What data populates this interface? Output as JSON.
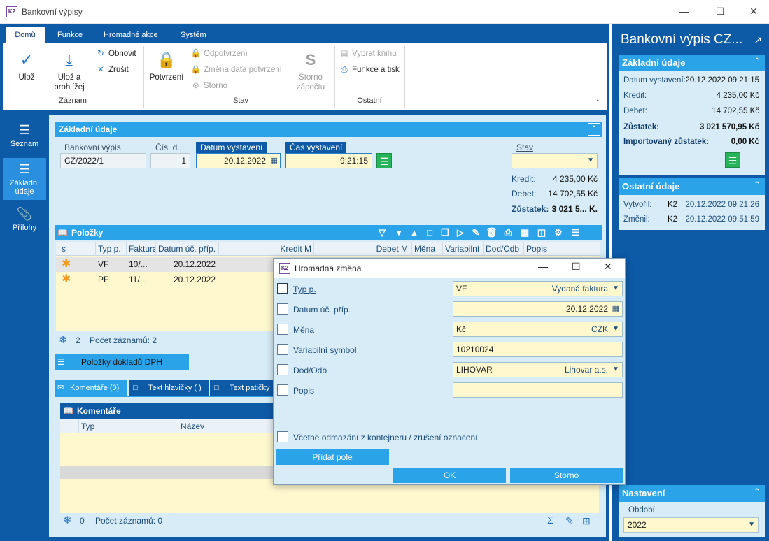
{
  "window": {
    "title": "Bankovní výpisy"
  },
  "ribbon": {
    "tabs": [
      "Domů",
      "Funkce",
      "Hromadné akce",
      "Systém"
    ],
    "zaznam": {
      "label": "Záznam",
      "uloz": "Ulož",
      "uloz_prohlizej": "Ulož a prohlížej",
      "obnovit": "Obnovit",
      "zrusit": "Zrušit"
    },
    "stav": {
      "label": "Stav",
      "potvrzeni": "Potvrzení",
      "odpotvrzeni": "Odpotvrzení",
      "zmena_data": "Změna data potvrzení",
      "storno": "Storno",
      "storno_zapoctu": "Storno zápočtu",
      "storno_icon_letter": "S"
    },
    "ostatni": {
      "label": "Ostatní",
      "vybrat_knihu": "Vybrat knihu",
      "funkce_tisk": "Funkce a tisk"
    }
  },
  "sidenav": [
    {
      "label": "Seznam",
      "icon": "list-icon"
    },
    {
      "label": "Základní údaje",
      "icon": "details-icon"
    },
    {
      "label": "Přílohy",
      "icon": "paperclip-icon"
    }
  ],
  "basic": {
    "title": "Základní údaje",
    "bank_statement_label": "Bankovní výpis",
    "bank_statement_value": "CZ/2022/1",
    "doc_no_label": "Čís. d...",
    "doc_no_value": "1",
    "issue_date_label": "Datum vystavení",
    "issue_date_value": "20.12.2022",
    "issue_time_label": "Čas vystavení",
    "issue_time_value": "9:21:15",
    "state_label": "Stav",
    "kredit_label": "Kredit:",
    "kredit_value": "4 235,00 Kč",
    "debet_label": "Debet:",
    "debet_value": "14 702,55 Kč",
    "zustatek_label": "Zůstatek:",
    "zustatek_value": "3 021 5... K."
  },
  "items": {
    "title": "Položky",
    "columns": [
      "s",
      "Typ p.",
      "Faktura",
      "Datum úč. příp.",
      "Kredit M",
      "Debet M",
      "Měna",
      "Variabilní",
      "Dod/Odb",
      "Popis"
    ],
    "rows": [
      {
        "typ": "VF",
        "faktura": "10/...",
        "datum": "20.12.2022"
      },
      {
        "typ": "PF",
        "faktura": "11/...",
        "datum": "20.12.2022"
      }
    ],
    "count": "2",
    "count_label": "Počet záznamů: 2",
    "dph_button": "Položky dokladů DPH"
  },
  "bottom_tabs": [
    "Komentáře (0)",
    "Text hlavičky ( )",
    "Text patičky"
  ],
  "comments": {
    "title": "Komentáře",
    "columns": [
      "Typ",
      "Název"
    ],
    "count": "0",
    "count_label": "Počet záznamů: 0"
  },
  "dialog": {
    "title": "Hromadná změna",
    "rows": [
      {
        "label": "Typ p.",
        "value": "VF",
        "right": "Vydaná faktura",
        "dropdown": true
      },
      {
        "label": "Datum úč. příp.",
        "value": "20.12.2022",
        "calendar": true
      },
      {
        "label": "Měna",
        "value": "Kč",
        "right": "CZK",
        "dropdown": true
      },
      {
        "label": "Variabilní symbol",
        "value": "10210024"
      },
      {
        "label": "Dod/Odb",
        "value": "LIHOVAR",
        "right": "Lihovar a.s.",
        "dropdown": true
      },
      {
        "label": "Popis",
        "value": ""
      }
    ],
    "include_label": "Včetně odmazání z kontejneru / zrušení označení",
    "add_field": "Přidat pole",
    "ok": "OK",
    "cancel": "Storno"
  },
  "right_panel": {
    "title": "Bankovní výpis CZ...",
    "basic": {
      "title": "Základní údaje",
      "datum_label": "Datum vystavení:",
      "datum_value": "20.12.2022 09:21:15",
      "kredit_label": "Kredit:",
      "kredit_value": "4 235,00 Kč",
      "debet_label": "Debet:",
      "debet_value": "14 702,55 Kč",
      "zustatek_label": "Zůstatek:",
      "zustatek_value": "3 021 570,95 Kč",
      "import_label": "Importovaný zůstatek:",
      "import_value": "0,00 Kč"
    },
    "other": {
      "title": "Ostatní údaje",
      "vytvoril_label": "Vytvořil:",
      "vytvoril_user": "K2",
      "vytvoril_value": "20.12.2022 09:21:26",
      "zmenil_label": "Změnil:",
      "zmenil_user": "K2",
      "zmenil_value": "20.12.2022 09:51:59"
    },
    "settings": {
      "title": "Nastavení",
      "period_label": "Období",
      "period_value": "2022"
    }
  },
  "colors": {
    "primary": "#0d5aa7",
    "accent": "#2aa3e8",
    "panel_bg": "#d7ecf7",
    "field_bg": "#fff8cf"
  }
}
